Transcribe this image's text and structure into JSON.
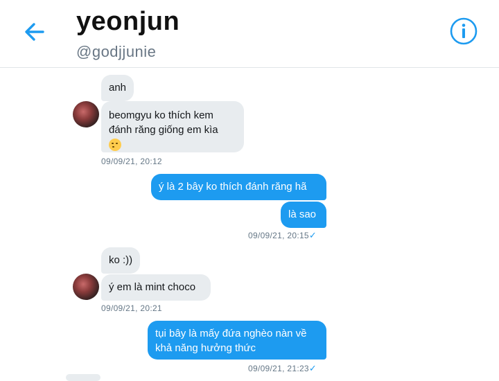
{
  "header": {
    "title": "yeonjun",
    "handle": "@godjjunie",
    "back_icon": "arrow-left-icon",
    "info_icon": "info-circle-icon",
    "accent": "#1d9bf0"
  },
  "messages": [
    {
      "direction": "in",
      "text": "anh"
    },
    {
      "direction": "in",
      "text": "beomgyu ko thích kem",
      "text2": "đánh răng giống em kìa",
      "emoji": "smiling-face-emoji"
    },
    {
      "direction": "in",
      "timestamp": "09/09/21, 20:12"
    },
    {
      "direction": "out",
      "text": "ý là 2 bây ko thích đánh răng hã"
    },
    {
      "direction": "out",
      "text": "là sao"
    },
    {
      "direction": "out",
      "timestamp": "09/09/21, 20:15",
      "read_icon": "checkmark-icon"
    },
    {
      "direction": "in",
      "text": "ko :))"
    },
    {
      "direction": "in",
      "text": "ý em là mint choco"
    },
    {
      "direction": "in",
      "timestamp": "09/09/21, 20:21"
    },
    {
      "direction": "out",
      "text": "tụi bây là mấy đứa nghèo nàn về",
      "text2": "khả năng hưởng thức"
    },
    {
      "direction": "out",
      "timestamp": "09/09/21, 21:23",
      "read_icon": "checkmark-icon"
    }
  ]
}
